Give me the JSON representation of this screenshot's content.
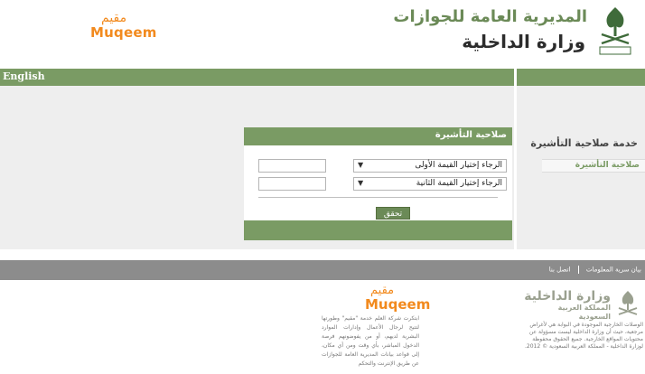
{
  "header": {
    "muqeem_ar": "مقيم",
    "muqeem_en": "Muqeem",
    "gdp_title": "المديرية العامة للجوازات",
    "moi_title": "وزارة الداخلية"
  },
  "nav": {
    "english": "English"
  },
  "form": {
    "title": "صلاحية التأشيرة",
    "select1": "الرجاء إختيار القيمة الأولى",
    "select2": "الرجاء إختيار القيمة الثانية",
    "verify_button": "تحقق"
  },
  "sidebar": {
    "service_title": "خدمة صلاحية التأشيرة",
    "service_link": "صلاحية التأشيرة"
  },
  "footer": {
    "links": [
      "بيان سرية المعلومات",
      "اتصل بنا"
    ],
    "muqeem_ar": "مقيم",
    "muqeem_en": "Muqeem",
    "muqeem_desc": "ابتكرت شركة العلم خدمة \"مقيم\" وطورتها لتتيح لرجال الأعمال وإدارات الموارد البشرية لديهم، أو من يفوضونهم فرصة الدخول المباشر، بأي وقت ومن أي مكان، إلى قواعد بيانات المديرية العامة للجوازات عن طريق الإنترنت والتحكم",
    "moi_l1": "وزارة الداخلية",
    "moi_l2": "المملكة العربية السعودية",
    "disclaimer": "الوصلات الخارجية الموجودة في البوابة هي لأغراض مرجعية، حيث أن وزارة الداخلية ليست مسؤولة عن محتويات المواقع الخارجية. جميع الحقوق محفوظة لوزارة الداخلية - المملكة العربية السعودية © 2012."
  },
  "colors": {
    "brand_green": "#7a9b64",
    "muqeem_orange": "#f28a1e",
    "footer_gray": "#8c8c8c"
  }
}
